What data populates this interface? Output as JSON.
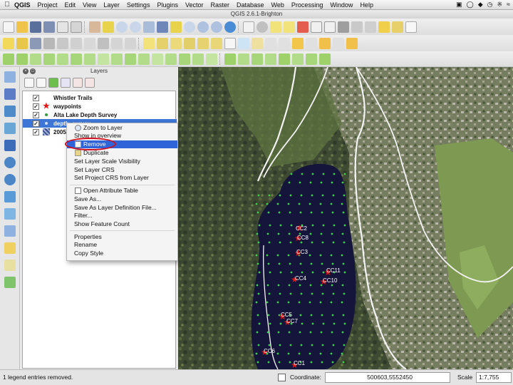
{
  "menubar": {
    "app": "QGIS",
    "items": [
      "Project",
      "Edit",
      "View",
      "Layer",
      "Settings",
      "Plugins",
      "Vector",
      "Raster",
      "Database",
      "Web",
      "Processing",
      "Window",
      "Help"
    ]
  },
  "window": {
    "title": "QGIS 2.6.1-Brighton"
  },
  "layers_panel": {
    "title": "Layers",
    "layers": [
      {
        "name": "Whistler Trails",
        "checked": true,
        "symbol": "line"
      },
      {
        "name": "waypoints",
        "checked": true,
        "symbol": "red-star"
      },
      {
        "name": "Alta Lake Depth Survey",
        "checked": true,
        "symbol": "green-dot"
      },
      {
        "name": "depth_survey",
        "checked": true,
        "symbol": "blue-dot",
        "selected": true
      },
      {
        "name": "2005",
        "checked": true,
        "symbol": "raster"
      }
    ]
  },
  "context_menu": {
    "items": [
      {
        "label": "Zoom to Layer",
        "icon": "zoom-icon"
      },
      {
        "label": "Show in overview"
      },
      {
        "label": "Remove",
        "icon": "remove-icon",
        "highlighted": true
      },
      {
        "label": "Duplicate",
        "icon": "duplicate-icon"
      },
      {
        "label": "Set Layer Scale Visibility"
      },
      {
        "label": "Set Layer CRS"
      },
      {
        "label": "Set Project CRS from Layer"
      },
      {
        "label": "Open Attribute Table",
        "icon": "table-icon"
      },
      {
        "label": "Save As..."
      },
      {
        "label": "Save As Layer Definition File..."
      },
      {
        "label": "Filter..."
      },
      {
        "label": "Show Feature Count"
      },
      {
        "label": "Properties"
      },
      {
        "label": "Rename"
      },
      {
        "label": "Copy Style"
      }
    ]
  },
  "map": {
    "waypoint_labels": [
      "CC2",
      "CC8",
      "CC3",
      "CC11",
      "CC4",
      "CC10",
      "CC5",
      "CC7",
      "CC6",
      "CC1"
    ]
  },
  "statusbar": {
    "message": "1 legend entries removed.",
    "coordinate_label": "Coordinate:",
    "coordinate_value": "500603,5552450",
    "scale_label": "Scale",
    "scale_value": "1:7,755"
  },
  "colors": {
    "selection": "#3d76d6",
    "menu_highlight": "#2f63d8",
    "annotation_ring": "#d0101e",
    "waypoint": "#e01818",
    "depth_point": "#39d24a",
    "lake": "#15143a"
  }
}
